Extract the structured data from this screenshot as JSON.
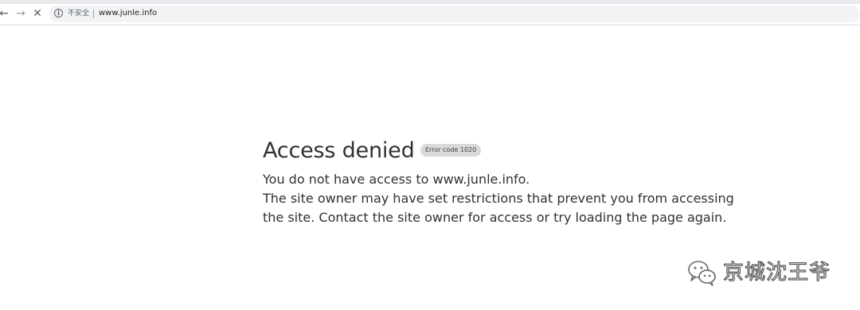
{
  "browser": {
    "security_label": "不安全",
    "url": "www.junle.info"
  },
  "page": {
    "title": "Access denied",
    "error_badge": "Error code 1020",
    "line1": "You do not have access to www.junle.info.",
    "line2": "The site owner may have set restrictions that prevent you from accessing the site. Contact the site owner for access or try loading the page again."
  },
  "watermark": {
    "text": "京城沈王爷"
  },
  "icons": {
    "back": "arrow-left-icon",
    "forward": "arrow-right-icon",
    "stop": "close-icon",
    "info": "info-circle-icon",
    "wechat": "wechat-icon"
  }
}
